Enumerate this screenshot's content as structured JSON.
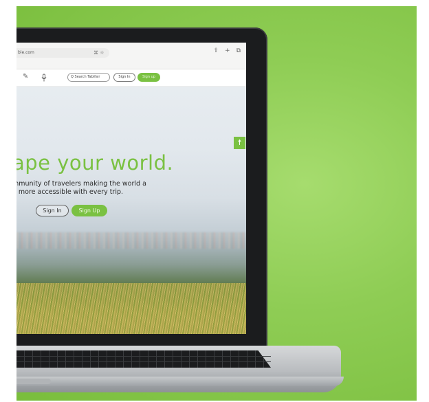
{
  "browser": {
    "url_fragment": "ble.com",
    "translate_icon": "translate-icon",
    "toolbar_icons": [
      "share-icon",
      "plus-icon",
      "tabs-icon"
    ],
    "toolbar_glyphs": [
      "⇪",
      "+",
      "⧉"
    ]
  },
  "site_header": {
    "edit_icon": "edit-icon",
    "mic_icon": "mic-icon",
    "search_placeholder": "Q Search Tabifair",
    "signin_label": "Sign In",
    "signup_label": "Sign up"
  },
  "hero": {
    "title": "ape your world.",
    "subtitle_line1": "mmunity of travelers making the world a",
    "subtitle_line2": "e more accessible with every trip.",
    "signin_label": "Sign In",
    "signup_label": "Sign Up"
  },
  "accessibility_button": {
    "icon": "accessibility-icon",
    "glyph": "☨"
  },
  "colors": {
    "brand_green": "#7ac142",
    "background_green": "#8fcd55",
    "laptop_bezel": "#1b1c1e"
  }
}
